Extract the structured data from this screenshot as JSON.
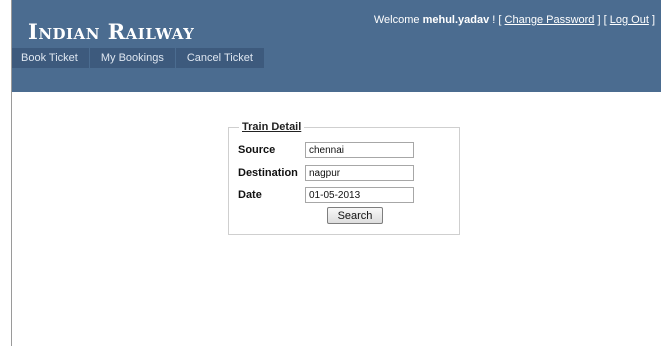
{
  "app": {
    "title": "Indian Railway"
  },
  "login": {
    "welcome_text": "Welcome",
    "username": "mehul.yadav",
    "exclaim": "!",
    "change_password": "Change Password",
    "logout": "Log Out"
  },
  "menu": {
    "items": [
      {
        "label": "Book Ticket"
      },
      {
        "label": "My Bookings"
      },
      {
        "label": "Cancel Ticket"
      }
    ]
  },
  "train_detail": {
    "legend": "Train Detail",
    "source_label": "Source",
    "source_value": "chennai",
    "destination_label": "Destination",
    "destination_value": "nagpur",
    "date_label": "Date",
    "date_value": "01-05-2013",
    "search_label": "Search"
  },
  "colors": {
    "header": "#4b6c90",
    "menu_item": "#3d5a7d",
    "text_on_header": "#ffffff"
  }
}
